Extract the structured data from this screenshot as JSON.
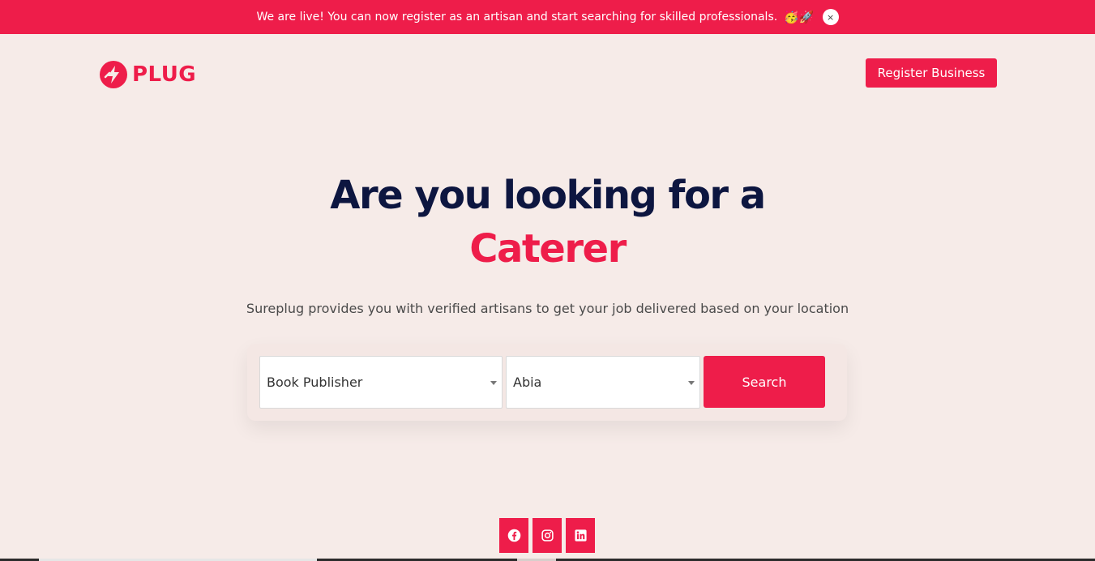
{
  "banner": {
    "text": "We are live! You can now register as an artisan and start searching for skilled professionals.",
    "emoji": "🥳🚀",
    "close_label": "×"
  },
  "header": {
    "logo_text": "PLUG",
    "register_label": "Register Business"
  },
  "hero": {
    "title_line1": "Are you looking for a",
    "title_accent": "Caterer",
    "subtitle": "Sureplug provides you with verified artisans to get your job delivered based on your location"
  },
  "search": {
    "category_value": "Book Publisher",
    "location_value": "Abia",
    "button_label": "Search"
  },
  "socials": [
    {
      "icon": "facebook-icon"
    },
    {
      "icon": "instagram-icon"
    },
    {
      "icon": "linkedin-icon"
    }
  ],
  "colors": {
    "accent": "#ee1d4a",
    "heading": "#0d1640",
    "background": "#f6ebe8"
  }
}
